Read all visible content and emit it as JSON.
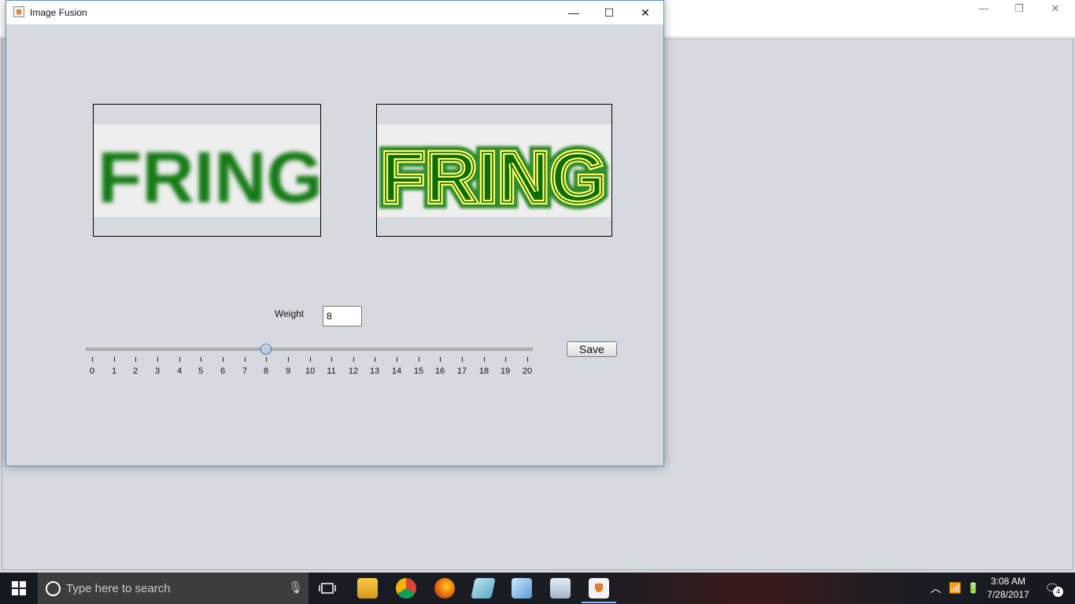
{
  "window": {
    "title": "Image Fusion",
    "minimize": "—",
    "maximize": "☐",
    "close": "✕"
  },
  "background_window": {
    "minimize": "—",
    "restore": "❐",
    "close": "✕"
  },
  "left_image": {
    "text": "FRING"
  },
  "right_image": {
    "text": "FRING"
  },
  "weight": {
    "label": "Weight",
    "value": "8"
  },
  "slider": {
    "min": 0,
    "max": 20,
    "value": 8,
    "ticks": [
      "0",
      "1",
      "2",
      "3",
      "4",
      "5",
      "6",
      "7",
      "8",
      "9",
      "10",
      "11",
      "12",
      "13",
      "14",
      "15",
      "16",
      "17",
      "18",
      "19",
      "20"
    ]
  },
  "save_label": "Save",
  "taskbar": {
    "search_placeholder": "Type here to search",
    "time": "3:08 AM",
    "date": "7/28/2017",
    "notification_count": "4",
    "apps": [
      "task-view",
      "file-explorer",
      "chrome",
      "firefox",
      "notes-app",
      "3d-box-app",
      "photos-app",
      "java-app"
    ]
  },
  "colors": {
    "window_bg": "#d6d9e0",
    "green": "#107c10",
    "yellow": "#ffff66",
    "taskbar": "#1b1d24"
  }
}
